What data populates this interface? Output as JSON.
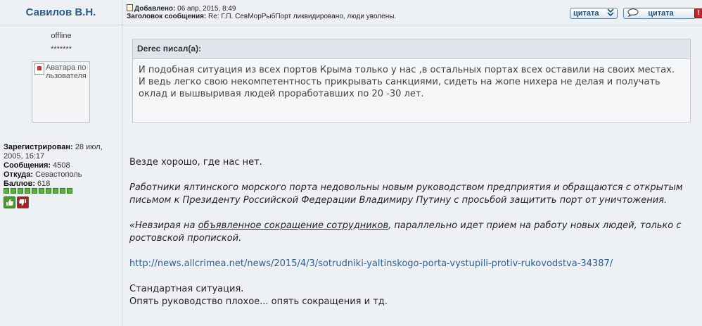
{
  "author": {
    "name": "Савилов В.Н.",
    "status": "offline",
    "stars": "*******",
    "avatar_alt": "Аватара пользователя",
    "registered_label": "Зарегистрирован:",
    "registered_value": " 28 июл, 2005, 16:17",
    "posts_label": "Сообщения:",
    "posts_value": " 4508",
    "from_label": "Откуда:",
    "from_value": " Севастополь",
    "points_label": "Баллов:",
    "points_value": " 618",
    "rating_segments": 10
  },
  "post": {
    "added_label": "Добавлено:",
    "added_value": " 06 апр, 2015, 8:49",
    "subject_label": "Заголовок сообщения:",
    "subject_value": " Re: Г.П. СевМорРыбПорт ликвидировано, люди уволены.",
    "quote_multi_label": "цитата",
    "quote_single_label": "цитата"
  },
  "quote": {
    "author_line": "Derec писал(а):",
    "line1": "И подобная ситуация из всех портов Крыма только у нас ,в остальных портах всех оставили на своих местах.",
    "line2": "И ведь легко свою некомпетентность прикрывать санкциями, сидеть на жопе нихера не делая и получать оклад и вышвыривая людей проработавших по 20 -30 лет."
  },
  "body": {
    "p1": "Везде хорошо, где нас нет.",
    "p2": "Работники ялтинского морского порта недовольны новым руководством предприятия и обращаются с открытым письмом к Президенту Российской Федерации Владимиру Путину с просьбой защитить порт от уничтожения.",
    "p3_start": "«Невзирая на ",
    "p3_underlined": "объявленное сокращение сотрудников",
    "p3_end": ", параллельно идет прием на работу новых людей, только с ростовской пропиской.",
    "link": "http://news.allcrimea.net/news/2015/4/3/sotrudniki-yaltinskogo-porta-vystupili-protiv-rukovodstva-34387/",
    "p5_line1": "Стандартная ситуация.",
    "p5_line2": "Опять руководство плохое... опять сокращения и тд."
  }
}
